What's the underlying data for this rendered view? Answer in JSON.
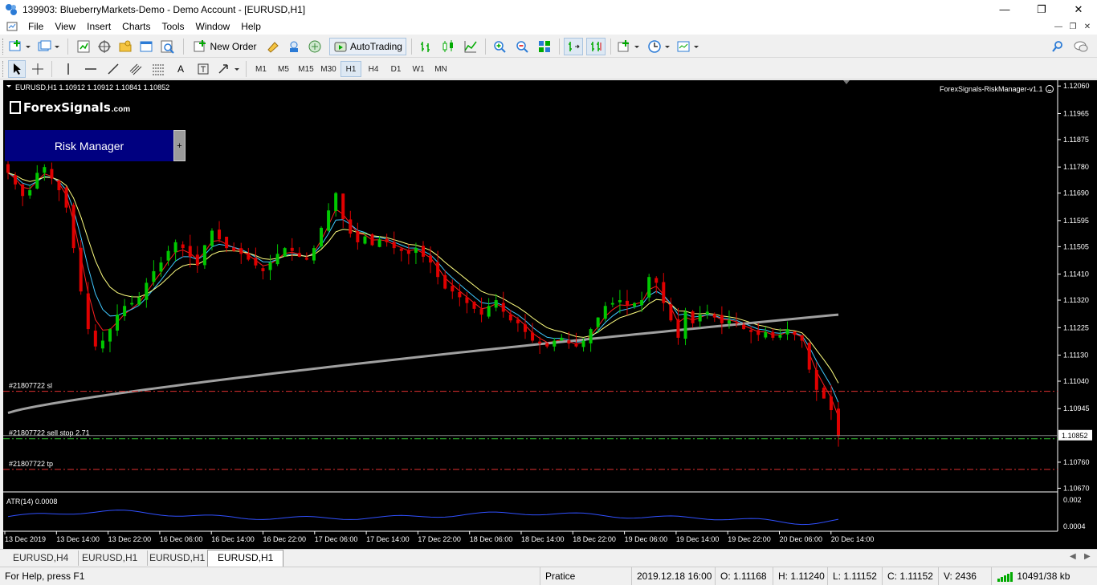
{
  "window": {
    "title": "139903: BlueberryMarkets-Demo - Demo Account - [EURUSD,H1]"
  },
  "menu": [
    "File",
    "View",
    "Insert",
    "Charts",
    "Tools",
    "Window",
    "Help"
  ],
  "toolbar": {
    "new_order": "New Order",
    "autotrading": "AutoTrading"
  },
  "timeframes": [
    "M1",
    "M5",
    "M15",
    "M30",
    "H1",
    "H4",
    "D1",
    "W1",
    "MN"
  ],
  "active_timeframe": "H1",
  "chart": {
    "info": "EURUSD,H1  1.10912 1.10912 1.10841 1.10852",
    "ea_label": "ForexSignals-RiskManager-v1.1",
    "logo_name": "ForexSignals",
    "logo_domain": ".com",
    "risk_button": "Risk Manager",
    "risk_plus": "+",
    "order_sl": "#21807722 sl",
    "order_entry": "#21807722 sell stop 2.71",
    "order_tp": "#21807722 tp",
    "atr_label": "ATR(14) 0.0008",
    "current_price": "1.10852",
    "price_ticks": [
      "1.12060",
      "1.11965",
      "1.11875",
      "1.11780",
      "1.11690",
      "1.11595",
      "1.11505",
      "1.11410",
      "1.11320",
      "1.11225",
      "1.11130",
      "1.11040",
      "1.10945",
      "1.10852",
      "1.10760",
      "1.10670"
    ],
    "atr_ticks": [
      "0.002",
      "0.0004"
    ],
    "time_ticks": [
      "13 Dec 2019",
      "13 Dec 14:00",
      "13 Dec 22:00",
      "16 Dec 06:00",
      "16 Dec 14:00",
      "16 Dec 22:00",
      "17 Dec 06:00",
      "17 Dec 14:00",
      "17 Dec 22:00",
      "18 Dec 06:00",
      "18 Dec 14:00",
      "18 Dec 22:00",
      "19 Dec 06:00",
      "19 Dec 14:00",
      "19 Dec 22:00",
      "20 Dec 06:00",
      "20 Dec 14:00"
    ],
    "colors": {
      "bull": "#00c800",
      "bear": "#e00000",
      "ma_fast": "#ff2020",
      "ma_mid": "#40c8ff",
      "ma_slow": "#ffff80",
      "ma_long": "#a0a0a0",
      "atr": "#3050ff"
    }
  },
  "chart_data": {
    "type": "candlestick",
    "symbol": "EURUSD",
    "timeframe": "H1",
    "ylim": [
      1.1066,
      1.1208
    ],
    "current_price": 1.10852,
    "order_levels": {
      "sl": 1.11005,
      "entry": 1.10841,
      "tp": 1.10735
    },
    "close_path": [
      1.1176,
      1.1172,
      1.1168,
      1.117,
      1.1176,
      1.1178,
      1.1174,
      1.117,
      1.1164,
      1.115,
      1.1135,
      1.1122,
      1.1116,
      1.1118,
      1.1122,
      1.1127,
      1.113,
      1.1131,
      1.1133,
      1.1138,
      1.1142,
      1.1145,
      1.1149,
      1.1152,
      1.115,
      1.1147,
      1.1144,
      1.1151,
      1.1156,
      1.1153,
      1.115,
      1.1149,
      1.1148,
      1.1146,
      1.1144,
      1.1142,
      1.1145,
      1.1148,
      1.115,
      1.1149,
      1.1147,
      1.1146,
      1.115,
      1.1157,
      1.1163,
      1.1169,
      1.116,
      1.1155,
      1.1152,
      1.1154,
      1.1151,
      1.1153,
      1.1152,
      1.115,
      1.1149,
      1.1148,
      1.115,
      1.1147,
      1.1145,
      1.114,
      1.1136,
      1.1135,
      1.1133,
      1.1131,
      1.1129,
      1.1127,
      1.113,
      1.1132,
      1.1128,
      1.1125,
      1.1124,
      1.1121,
      1.1118,
      1.1117,
      1.1116,
      1.1118,
      1.1119,
      1.1117,
      1.1116,
      1.1118,
      1.1122,
      1.1126,
      1.113,
      1.1131,
      1.1132,
      1.113,
      1.1131,
      1.1132,
      1.114,
      1.1138,
      1.1131,
      1.1125,
      1.1119,
      1.1128,
      1.1124,
      1.1127,
      1.1128,
      1.1126,
      1.1124,
      1.1125,
      1.1124,
      1.1122,
      1.1121,
      1.112,
      1.1121,
      1.1119,
      1.112,
      1.1122,
      1.112,
      1.1118,
      1.1108,
      1.1101,
      1.1098,
      1.1094,
      1.1085
    ],
    "atr_ylim": [
      0.0004,
      0.002
    ]
  },
  "tabs": [
    "EURUSD,H4",
    "EURUSD,H1",
    "EURUSD,H1",
    "EURUSD,H1"
  ],
  "active_tab": 3,
  "status": {
    "help": "For Help, press F1",
    "profile": "Pratice",
    "time": "2019.12.18 16:00",
    "open": "O: 1.11168",
    "high": "H: 1.11240",
    "low": "L: 1.11152",
    "close": "C: 1.11152",
    "volume": "V: 2436",
    "traffic": "10491/38 kb"
  }
}
